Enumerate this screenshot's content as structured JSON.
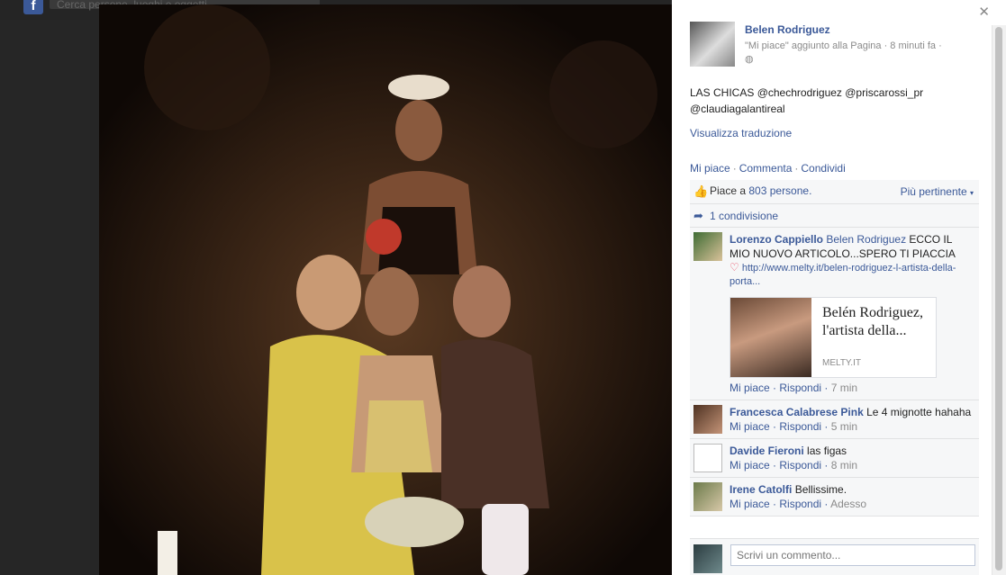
{
  "topbar": {
    "search_placeholder": "Cerca persone, luoghi e oggetti"
  },
  "post": {
    "author": "Belen Rodriguez",
    "meta": "\"Mi piace\" aggiunto alla Pagina · 8 minuti fa ·",
    "globe_icon": "globe-icon",
    "text": "LAS CHICAS @chechrodriguez @priscarossi_pr @claudiagalantireal",
    "translate_link": "Visualizza traduzione",
    "actions": [
      "Mi piace",
      "Commenta",
      "Condividi"
    ]
  },
  "ufi": {
    "likes_prefix": "Piace a ",
    "likes_count": "803 persone.",
    "sort_label": "Più pertinente",
    "shares": "1 condivisione"
  },
  "comments": [
    {
      "name": "Lorenzo Cappiello",
      "mention": "Belen Rodriguez",
      "text": " ECCO IL MIO NUOVO ARTICOLO...SPERO TI PIACCIA",
      "link": "http://www.melty.it/belen-rodriguez-l-artista-della-porta...",
      "preview_title": "Belén Rodriguez, l'artista della...",
      "preview_source": "MELTY.IT",
      "like": "Mi piace",
      "reply": "Rispondi",
      "time": "7 min"
    },
    {
      "name": "Francesca Calabrese Pink",
      "text": "Le 4 mignotte hahaha",
      "like": "Mi piace",
      "reply": "Rispondi",
      "time": "5 min"
    },
    {
      "name": "Davide Fieroni",
      "text": "las figas",
      "like": "Mi piace",
      "reply": "Rispondi",
      "time": "8 min"
    },
    {
      "name": "Irene Catolfi",
      "text": "Bellissime.",
      "like": "Mi piace",
      "reply": "Rispondi",
      "time": "Adesso"
    }
  ],
  "compose": {
    "placeholder": "Scrivi un commento..."
  },
  "colors": {
    "link": "#3b5998",
    "ufi_bg": "#f6f7f8"
  }
}
